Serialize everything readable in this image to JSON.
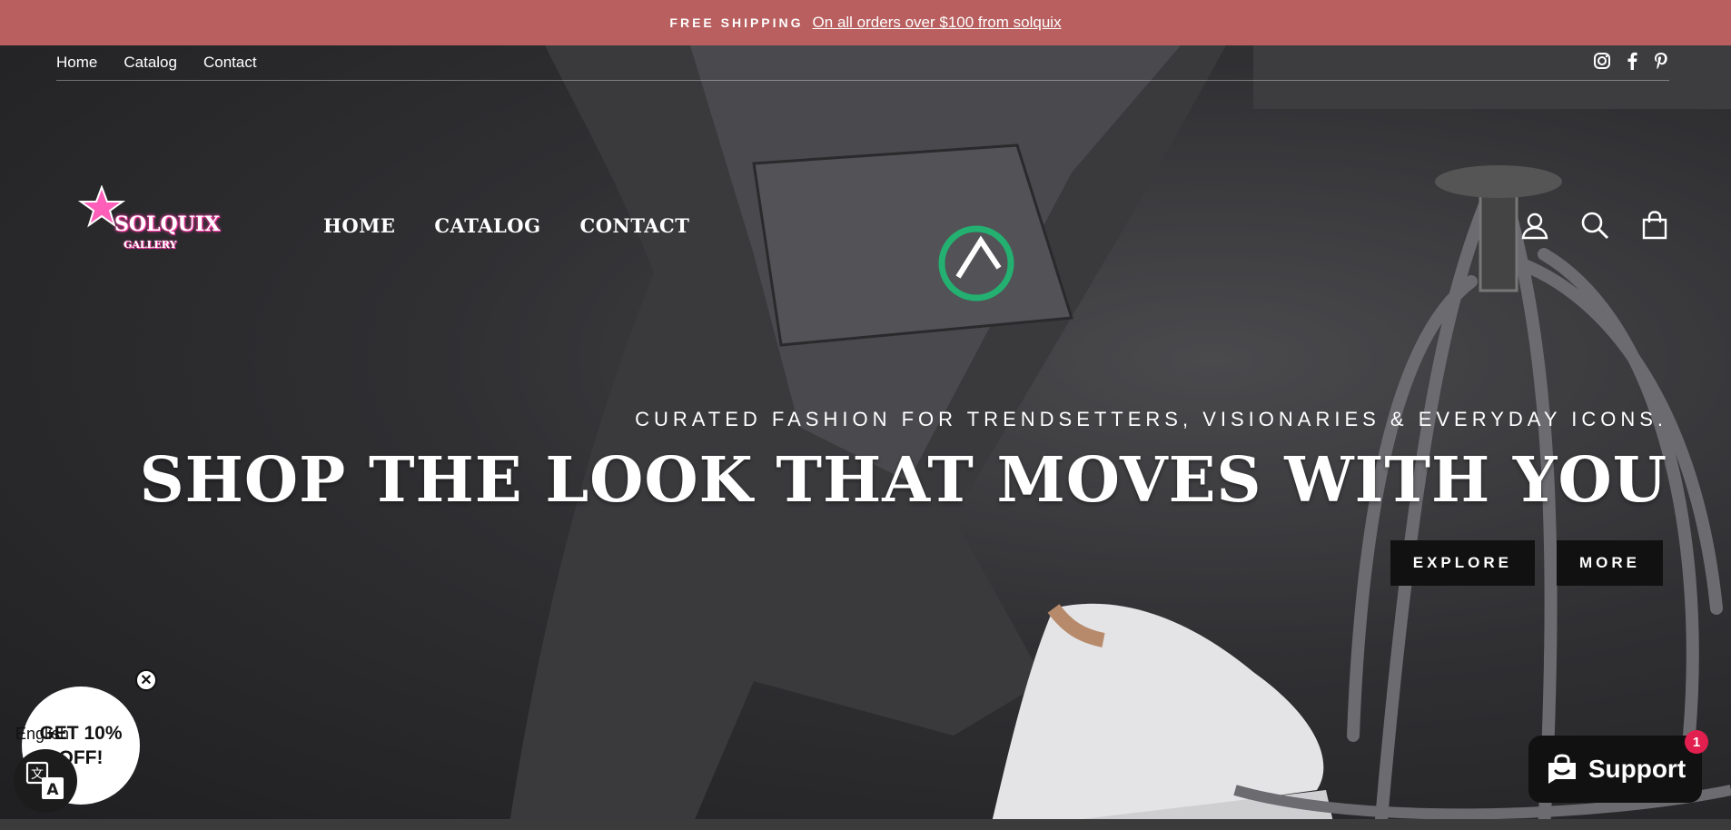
{
  "announcement": {
    "strong": "FREE SHIPPING",
    "link": "On all orders over $100 from solquix"
  },
  "utility_nav": {
    "items": [
      "Home",
      "Catalog",
      "Contact"
    ]
  },
  "social": {
    "icons": [
      "instagram-icon",
      "facebook-icon",
      "pinterest-icon"
    ]
  },
  "logo": {
    "name": "SOLQUIX",
    "sub": "GALLERY"
  },
  "main_nav": {
    "items": [
      "HOME",
      "CATALOG",
      "CONTACT"
    ]
  },
  "header_icons": [
    "account-icon",
    "search-icon",
    "cart-icon"
  ],
  "hero": {
    "tagline": "CURATED FASHION FOR TRENDSETTERS, VISIONARIES & EVERYDAY ICONS.",
    "headline": "SHOP THE LOOK THAT MOVES WITH YOU",
    "buttons": [
      "EXPLORE",
      "MORE"
    ]
  },
  "popup": {
    "line1": "GET 10%",
    "line2": "OFF!"
  },
  "language": {
    "label": "English"
  },
  "support": {
    "label": "Support",
    "badge": "1"
  },
  "colors": {
    "announcement": "#b95f5f",
    "logo_pink": "#ff3da8",
    "button": "#111111",
    "badge": "#e2204f"
  }
}
